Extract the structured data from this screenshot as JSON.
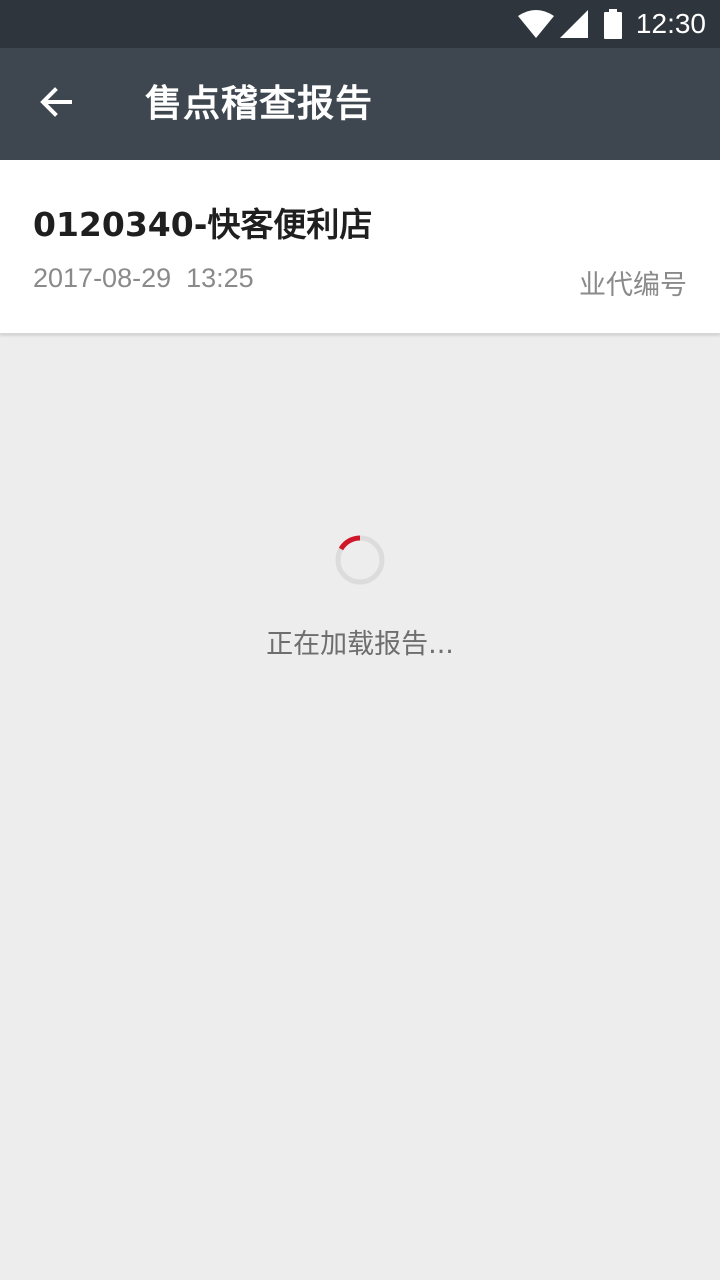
{
  "status_bar": {
    "time": "12:30",
    "icons": [
      "wifi-icon",
      "cellular-signal-icon",
      "battery-icon"
    ]
  },
  "toolbar": {
    "back_icon": "arrow-left-icon",
    "title": "售点稽查报告"
  },
  "store": {
    "name": "0120340-快客便利店",
    "datetime": "2017-08-29  13:25",
    "agent_code_label": "业代编号"
  },
  "loading": {
    "text": "正在加载报告..."
  },
  "colors": {
    "status_bar_bg": "#2f353c",
    "toolbar_bg": "#3e464f",
    "page_bg": "#ededed",
    "card_bg": "#ffffff",
    "spinner_accent": "#d0172a"
  }
}
